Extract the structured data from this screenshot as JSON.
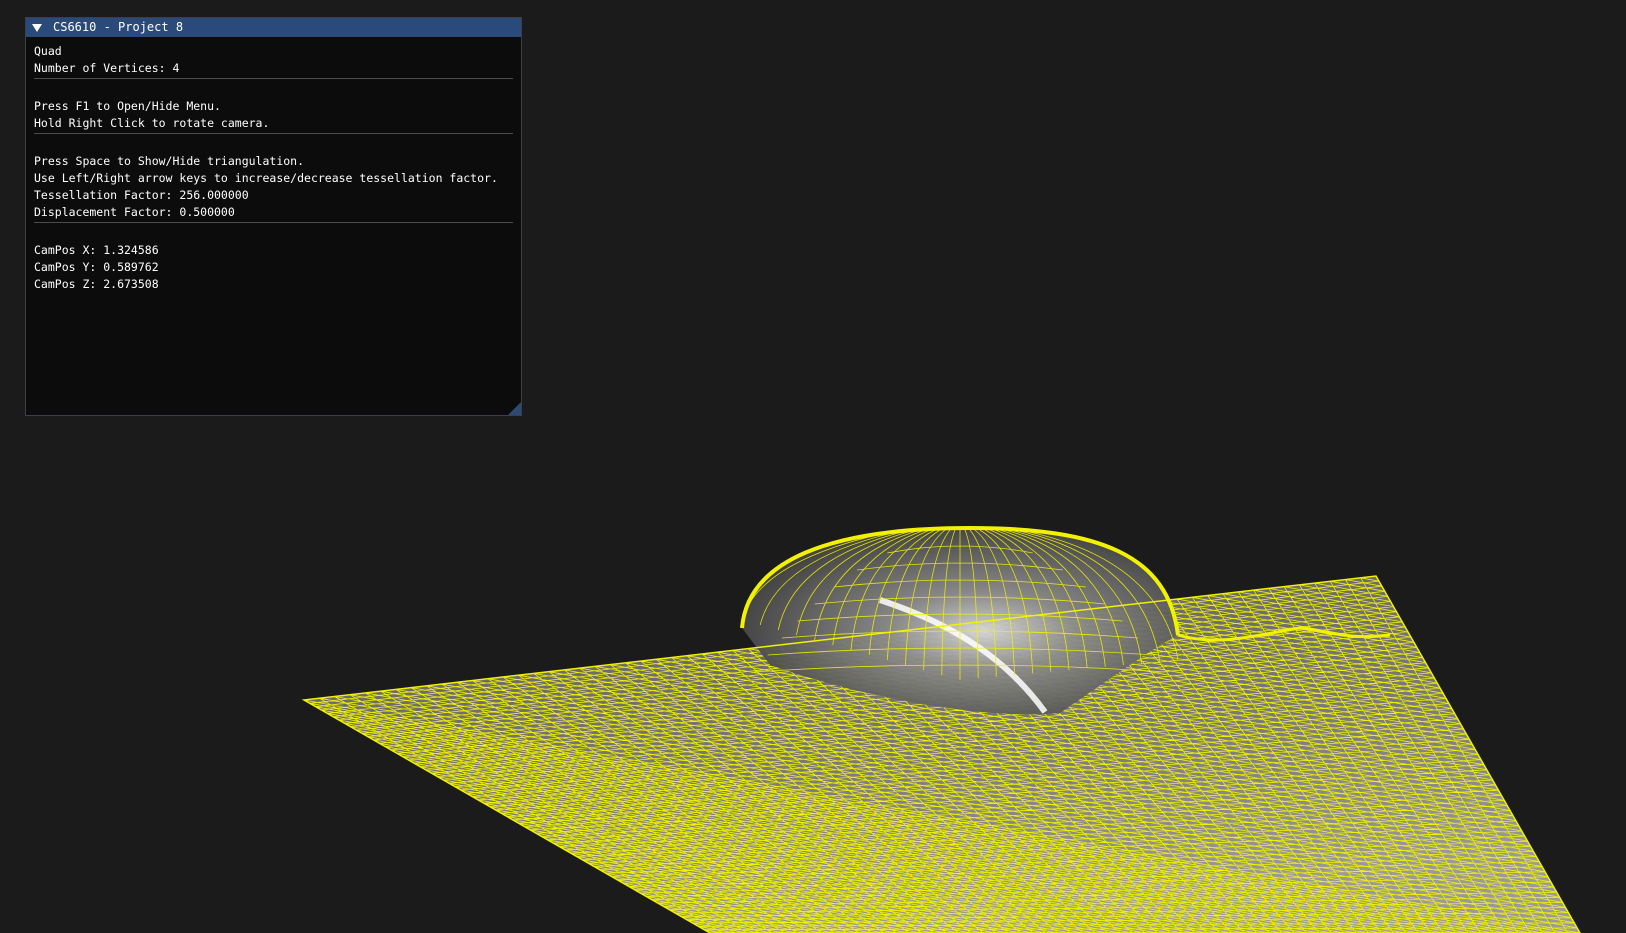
{
  "window": {
    "title": "CS6610 - Project 8"
  },
  "panel": {
    "model_name": "Quad",
    "vertex_count_label": "Number of Vertices: 4",
    "help_menu": "Press F1 to Open/Hide Menu.",
    "help_camera": "Hold Right Click to rotate camera.",
    "help_triangulation": "Press Space to Show/Hide triangulation.",
    "help_tessellation": "Use Left/Right arrow keys to increase/decrease tessellation factor.",
    "tessellation_factor": "Tessellation Factor: 256.000000",
    "displacement_factor": "Displacement Factor: 0.500000",
    "campos_x": "CamPos X: 1.324586",
    "campos_y": "CamPos Y: 0.589762",
    "campos_z": "CamPos Z: 2.673508"
  },
  "colors": {
    "background": "#1b1b1b",
    "title_bar": "#294a7a",
    "wireframe": "#f2f200",
    "surface": "#8a8a8a"
  }
}
